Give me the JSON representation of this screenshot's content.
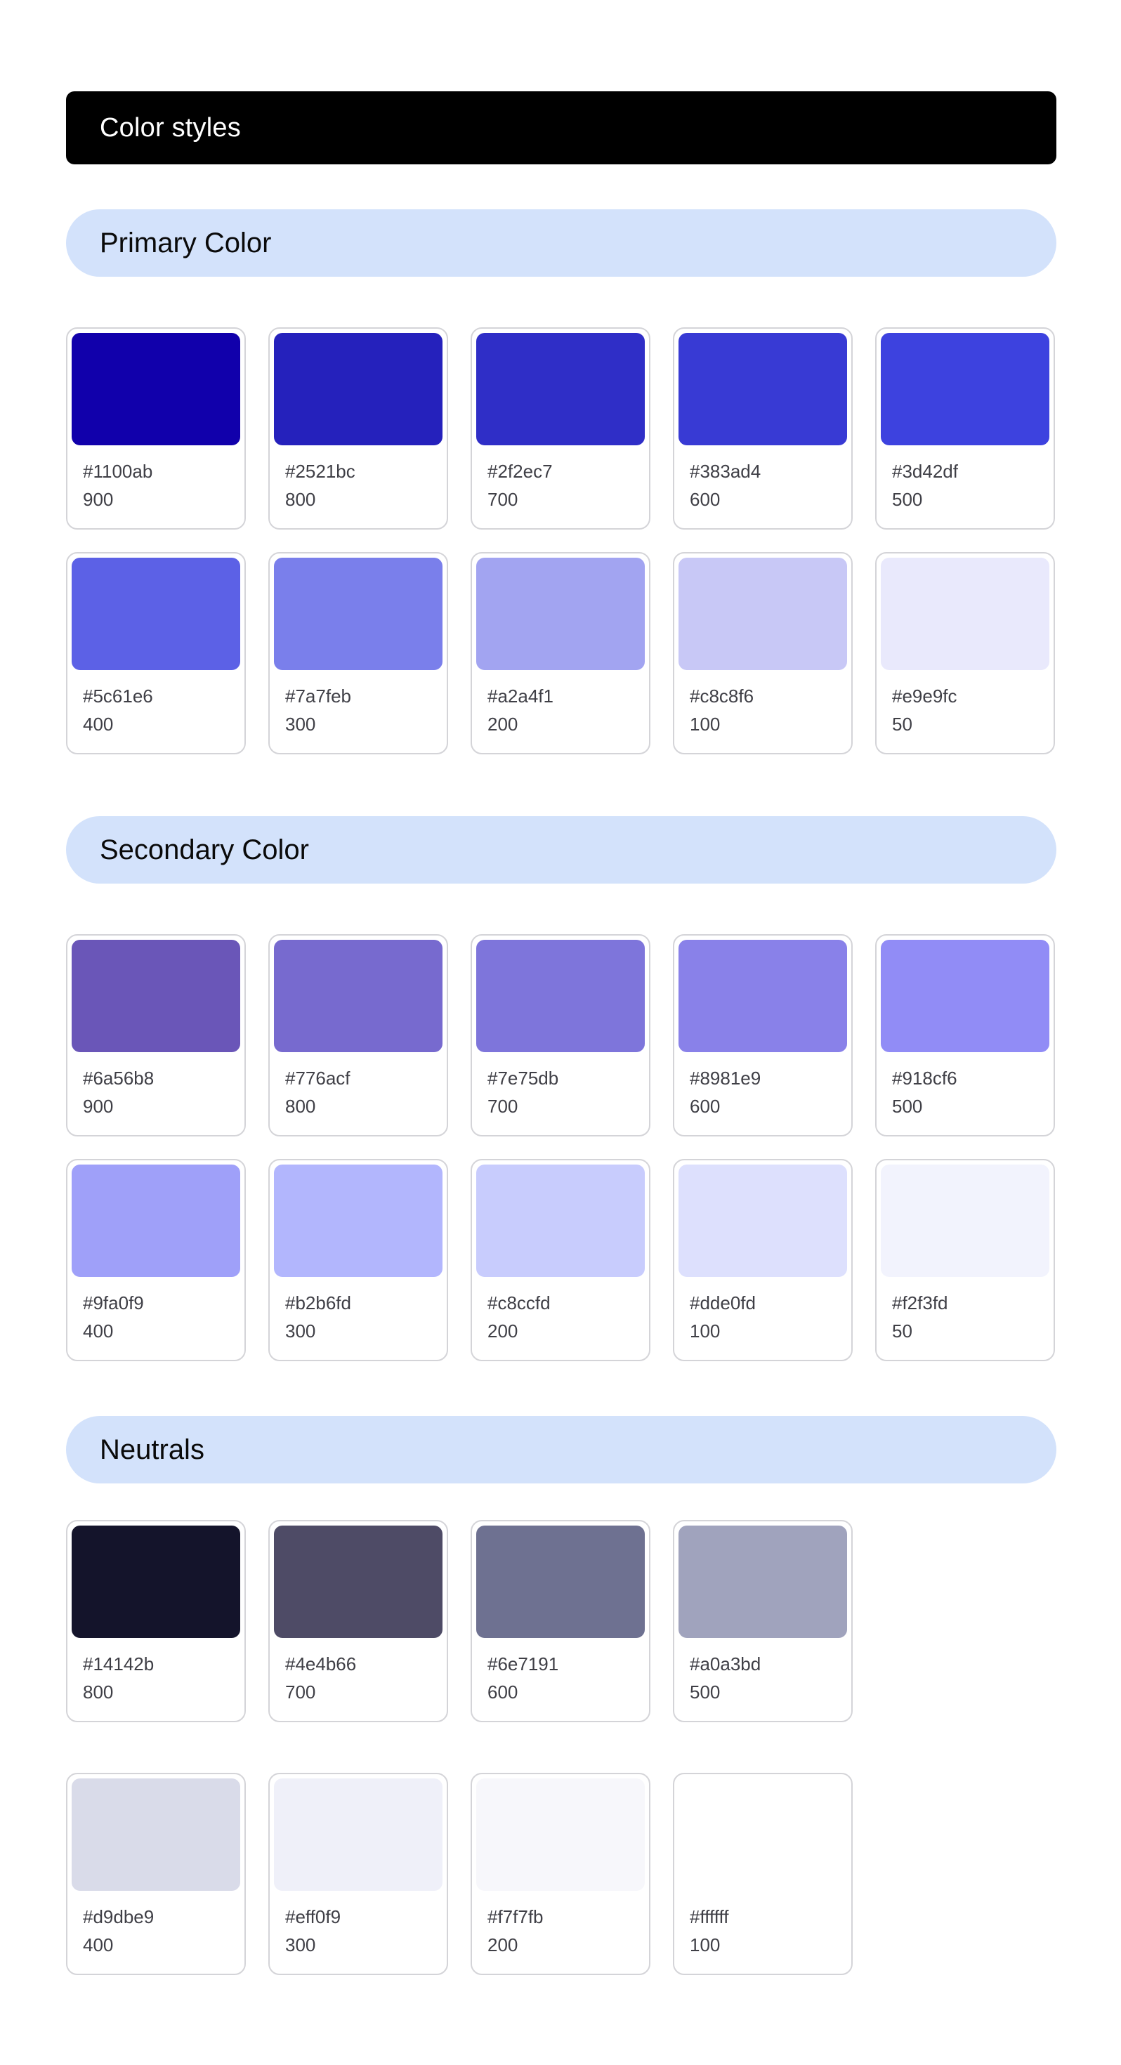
{
  "title": "Color styles",
  "sections": [
    {
      "name": "Primary Color",
      "rows": [
        [
          {
            "hex": "#1100ab",
            "label": "#1100ab",
            "shade": "900"
          },
          {
            "hex": "#2521bc",
            "label": "#2521bc",
            "shade": "800"
          },
          {
            "hex": "#2f2ec7",
            "label": "#2f2ec7",
            "shade": "700"
          },
          {
            "hex": "#383ad4",
            "label": "#383ad4",
            "shade": "600"
          },
          {
            "hex": "#3d42df",
            "label": "#3d42df",
            "shade": "500"
          }
        ],
        [
          {
            "hex": "#5c61e6",
            "label": "#5c61e6",
            "shade": "400"
          },
          {
            "hex": "#7a7feb",
            "label": "#7a7feb",
            "shade": "300"
          },
          {
            "hex": "#a2a4f1",
            "label": "#a2a4f1",
            "shade": "200"
          },
          {
            "hex": "#c8c8f6",
            "label": "#c8c8f6",
            "shade": "100"
          },
          {
            "hex": "#e9e9fc",
            "label": "#e9e9fc",
            "shade": "50"
          }
        ]
      ]
    },
    {
      "name": "Secondary Color",
      "rows": [
        [
          {
            "hex": "#6a56b8",
            "label": "#6a56b8",
            "shade": "900"
          },
          {
            "hex": "#776acf",
            "label": "#776acf",
            "shade": "800"
          },
          {
            "hex": "#7e75db",
            "label": "#7e75db",
            "shade": "700"
          },
          {
            "hex": "#8981e9",
            "label": "#8981e9",
            "shade": "600"
          },
          {
            "hex": "#918cf6",
            "label": "#918cf6",
            "shade": "500"
          }
        ],
        [
          {
            "hex": "#9fa0f9",
            "label": "#9fa0f9",
            "shade": "400"
          },
          {
            "hex": "#b2b6fd",
            "label": "#b2b6fd",
            "shade": "300"
          },
          {
            "hex": "#c8ccfd",
            "label": "#c8ccfd",
            "shade": "200"
          },
          {
            "hex": "#dde0fd",
            "label": "#dde0fd",
            "shade": "100"
          },
          {
            "hex": "#f2f3fd",
            "label": "#f2f3fd",
            "shade": "50"
          }
        ]
      ]
    },
    {
      "name": "Neutrals",
      "rows": [
        [
          {
            "hex": "#14142b",
            "label": "#14142b",
            "shade": "800"
          },
          {
            "hex": "#4e4b66",
            "label": "#4e4b66",
            "shade": "700"
          },
          {
            "hex": "#6e7191",
            "label": "#6e7191",
            "shade": "600"
          },
          {
            "hex": "#a0a3bd",
            "label": "#a0a3bd",
            "shade": "500"
          }
        ],
        [
          {
            "hex": "#d9dbe9",
            "label": "#d9dbe9",
            "shade": "400"
          },
          {
            "hex": "#eff0f9",
            "label": "#eff0f9",
            "shade": "300"
          },
          {
            "hex": "#f7f7fb",
            "label": "#f7f7fb",
            "shade": "200"
          },
          {
            "hex": "#ffffff",
            "label": "#ffffff",
            "shade": "100"
          }
        ]
      ]
    }
  ]
}
